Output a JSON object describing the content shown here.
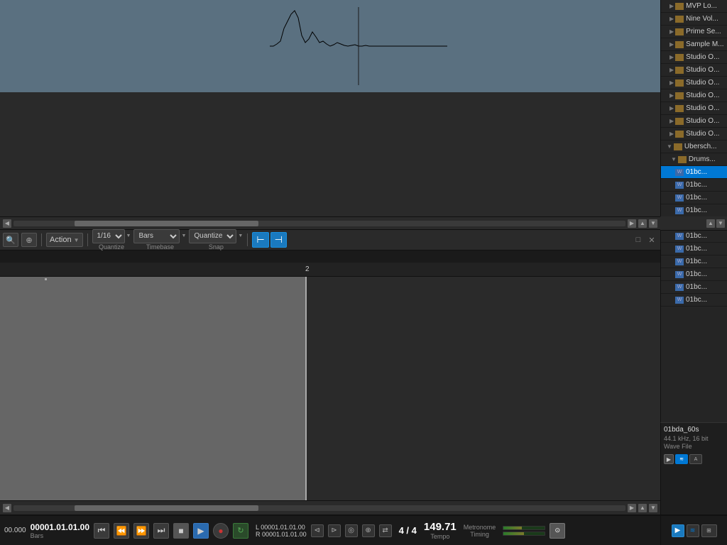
{
  "waveform": {
    "area_color": "#5a7080",
    "bg_color": "#2a2a2a"
  },
  "toolbar": {
    "quantize_value": "1/16",
    "timebase_value": "Bars",
    "snap_value": "Quantize",
    "quantize_label": "Quantize",
    "timebase_label": "Timebase",
    "snap_label": "Snap",
    "action_label": "Action",
    "close_label": "✕",
    "maximize_label": "□"
  },
  "timeline": {
    "marker_2": "2"
  },
  "right_panel": {
    "items": [
      {
        "type": "folder",
        "name": "MVP Lo...",
        "indent": 1
      },
      {
        "type": "folder",
        "name": "Nine Vol...",
        "indent": 1
      },
      {
        "type": "folder",
        "name": "Prime Se...",
        "indent": 1
      },
      {
        "type": "folder",
        "name": "Sample M...",
        "indent": 1
      },
      {
        "type": "folder",
        "name": "Studio O...",
        "indent": 1
      },
      {
        "type": "folder",
        "name": "Studio O...",
        "indent": 1
      },
      {
        "type": "folder",
        "name": "Studio O...",
        "indent": 1
      },
      {
        "type": "folder",
        "name": "Studio O...",
        "indent": 1
      },
      {
        "type": "folder",
        "name": "Studio O...",
        "indent": 1
      },
      {
        "type": "folder",
        "name": "Studio O...",
        "indent": 1
      },
      {
        "type": "folder",
        "name": "Studio O...",
        "indent": 1
      },
      {
        "type": "folder",
        "name": "Ueberschall",
        "indent": 0,
        "expanded": true
      },
      {
        "type": "folder",
        "name": "Drums...",
        "indent": 1,
        "expanded": true
      },
      {
        "type": "wav",
        "name": "01bc...",
        "indent": 2,
        "selected": true
      },
      {
        "type": "wav",
        "name": "01bc...",
        "indent": 2
      },
      {
        "type": "wav",
        "name": "01bc...",
        "indent": 2
      },
      {
        "type": "wav",
        "name": "01bc...",
        "indent": 2
      },
      {
        "type": "wav",
        "name": "01bc...",
        "indent": 2
      },
      {
        "type": "wav",
        "name": "01bc...",
        "indent": 2
      },
      {
        "type": "wav",
        "name": "01bc...",
        "indent": 2
      },
      {
        "type": "wav",
        "name": "01bc...",
        "indent": 2
      },
      {
        "type": "wav",
        "name": "01bc...",
        "indent": 2
      },
      {
        "type": "wav",
        "name": "01bc...",
        "indent": 2
      },
      {
        "type": "wav",
        "name": "01bc...",
        "indent": 2
      },
      {
        "type": "wav",
        "name": "01bc...",
        "indent": 2
      }
    ],
    "file_name": "01bda_60s",
    "file_freq": "44.1 kHz, 16 bit",
    "file_type": "Wave File"
  },
  "transport": {
    "time_seconds": "00.000",
    "position_bars": "00001.01.01.00",
    "position_label": "Bars",
    "loop_l": "L 00001.01.01.00",
    "loop_r": "R 00001.01.01.00",
    "time_sig_top": "4",
    "time_sig_bottom": "4",
    "tempo": "149.71",
    "tempo_label": "Tempo",
    "metronome_label": "Metronome",
    "timing_label": "Timing",
    "buttons": {
      "rewind_to_start": "⏮",
      "rewind": "⏪",
      "forward": "⏩",
      "fast_forward": "⏭",
      "stop": "■",
      "play": "▶",
      "record": "●",
      "loop": "↻"
    }
  }
}
